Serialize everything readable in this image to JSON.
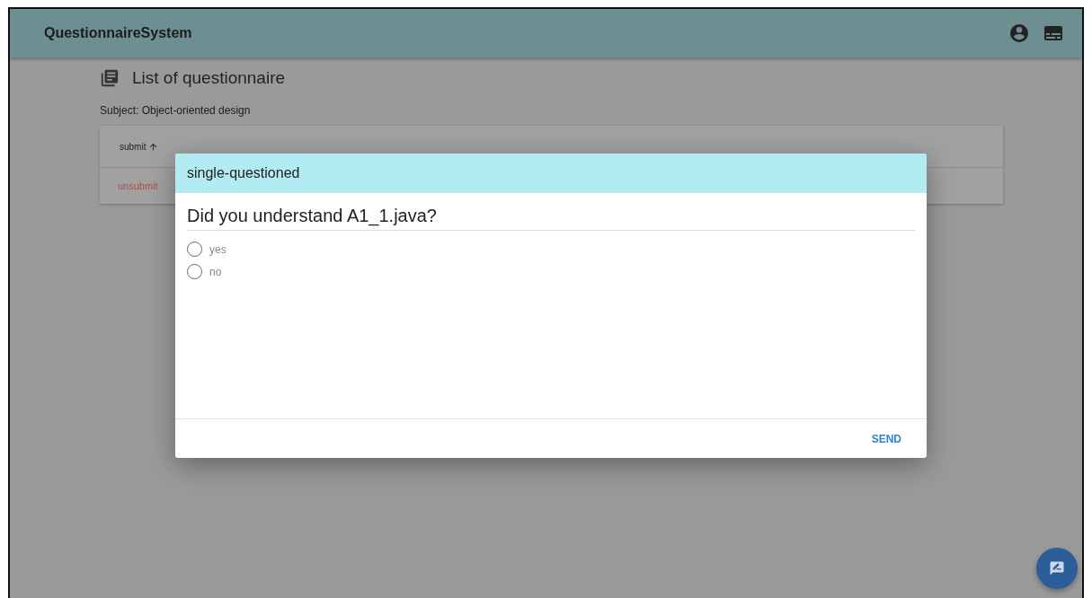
{
  "app_bar": {
    "title": "QuestionnaireSystem"
  },
  "page": {
    "heading": "List of questionnaire",
    "subject": "Subject: Object-oriented design",
    "table": {
      "columns": [
        {
          "label": "submit",
          "sorted": true
        }
      ],
      "rows": [
        {
          "status": "unsubmit"
        }
      ]
    }
  },
  "dialog": {
    "title": "single-questioned",
    "question": "Did you understand A1_1.java?",
    "options": [
      {
        "label": "yes",
        "selected": false
      },
      {
        "label": "no",
        "selected": false
      }
    ],
    "actions": [
      "SEND"
    ]
  }
}
